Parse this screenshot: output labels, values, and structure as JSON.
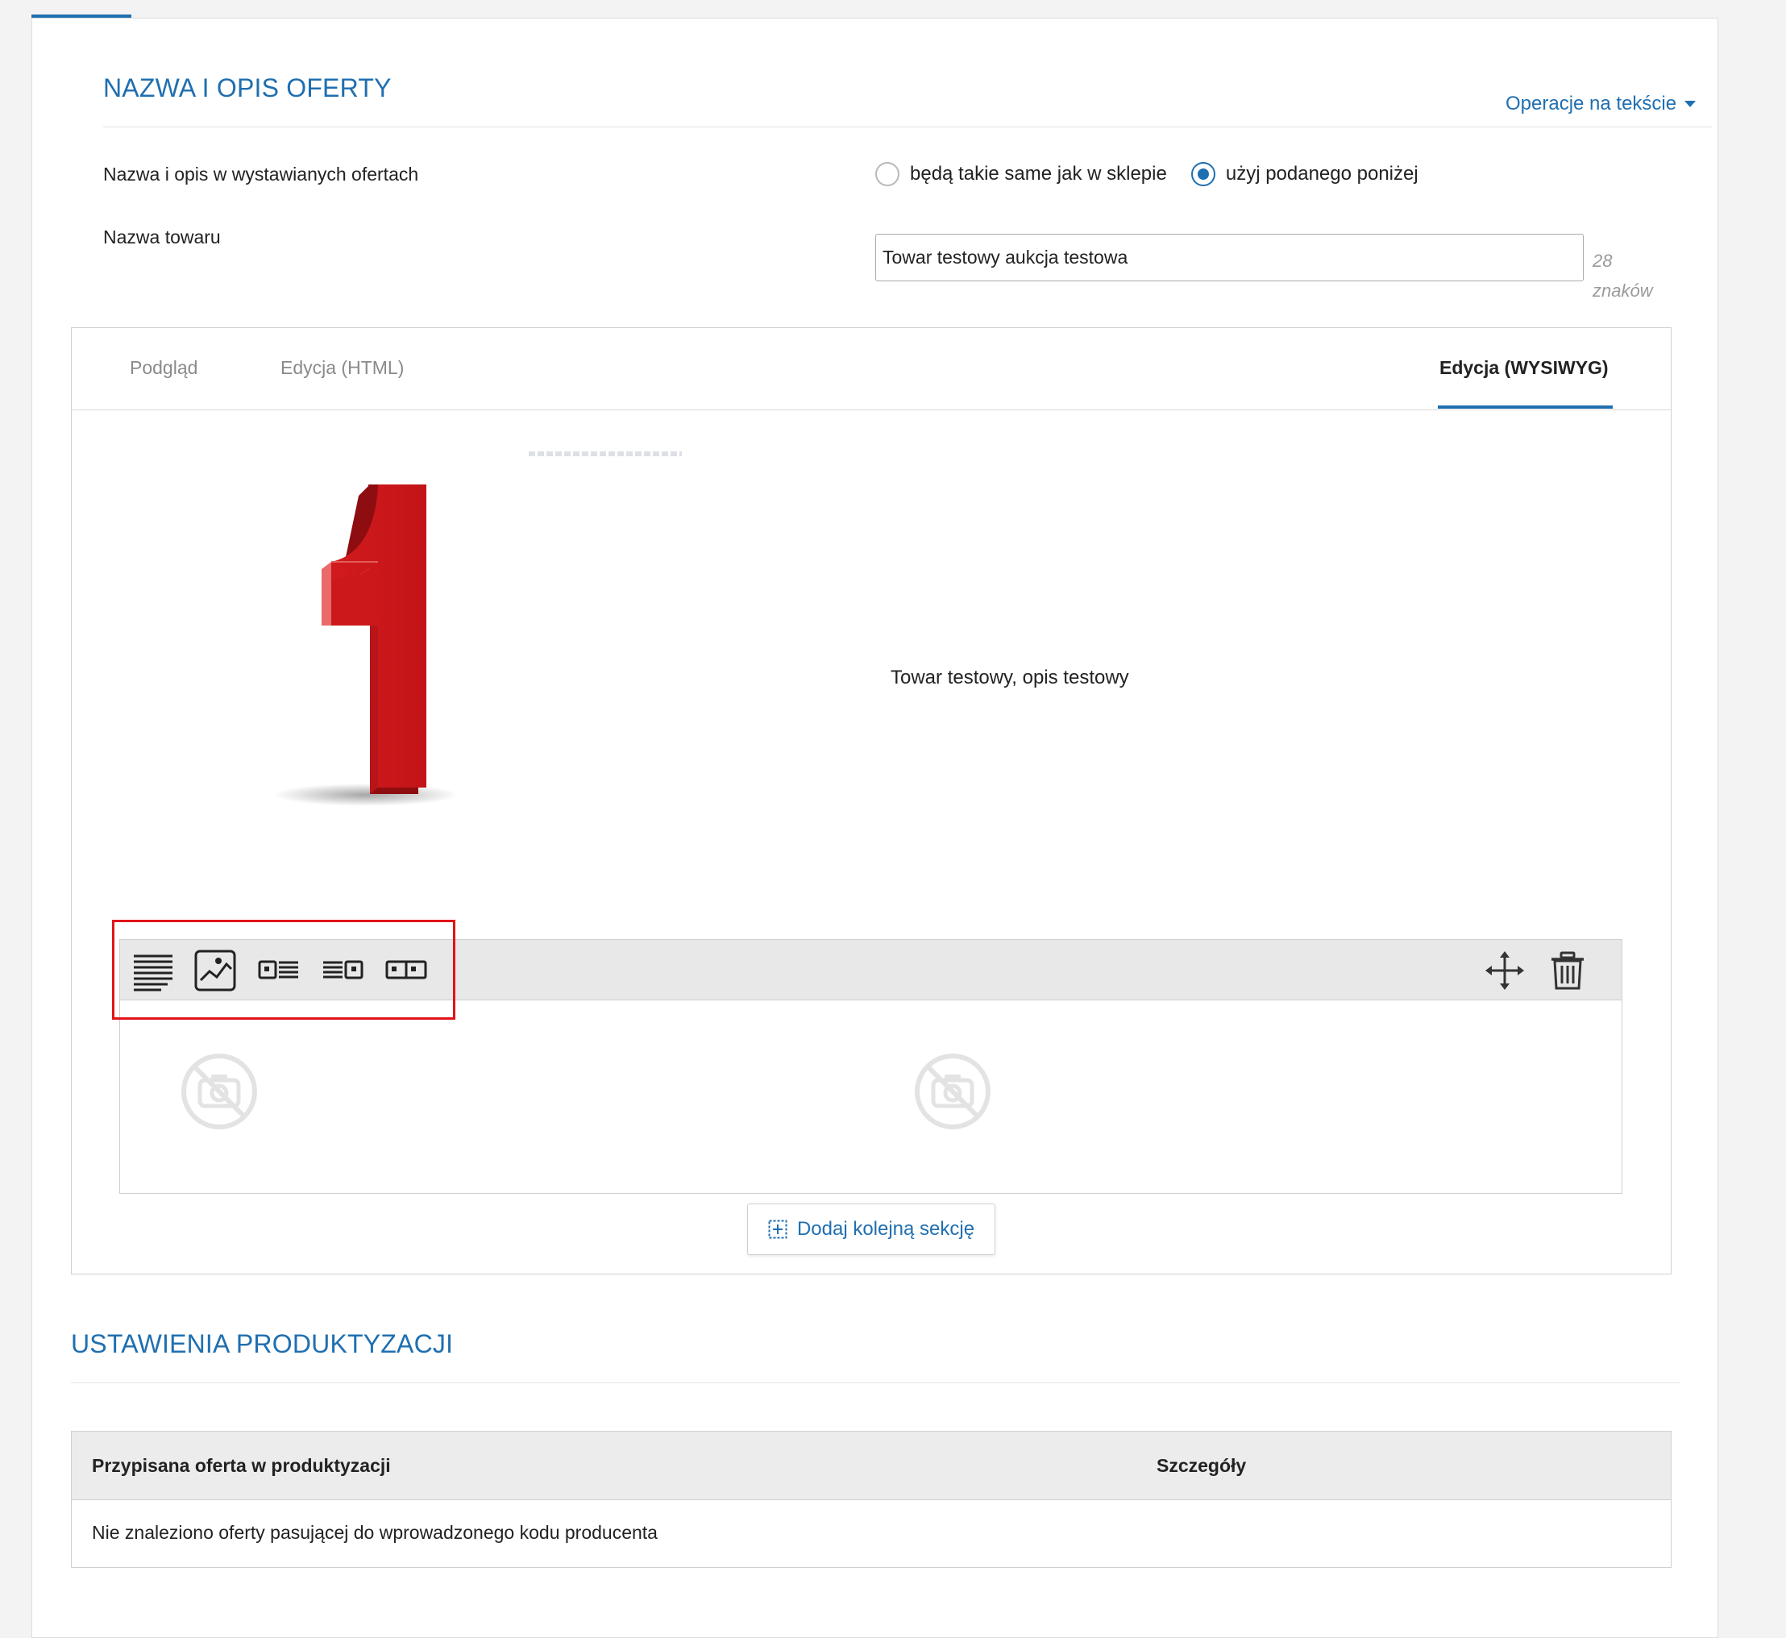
{
  "section1": {
    "title": "NAZWA I OPIS OFERTY",
    "ops_link": "Operacje na tekście"
  },
  "name_desc_row": {
    "label": "Nazwa i opis w wystawianych ofertach",
    "options": [
      {
        "label": "będą takie same jak w sklepie",
        "checked": false
      },
      {
        "label": "użyj podanego poniżej",
        "checked": true
      }
    ]
  },
  "product_name": {
    "label": "Nazwa towaru",
    "value": "Towar testowy aukcja testowa",
    "count": "28",
    "count_unit": "znaków"
  },
  "editor": {
    "tabs": [
      "Podgląd",
      "Edycja (HTML)",
      "Edycja (WYSIWYG)"
    ],
    "active_tab": "Edycja (WYSIWYG)",
    "description_text": "Towar testowy, opis testowy",
    "toolbar_tools": [
      "text-only-icon",
      "image-only-icon",
      "image-left-text-right-icon",
      "text-left-image-right-icon",
      "two-images-icon"
    ],
    "add_section_label": "Dodaj kolejną sekcję",
    "accent_color": "#1f6fb0",
    "highlight_color": "#e0141b"
  },
  "section2": {
    "title": "USTAWIENIA PRODUKTYZACJI",
    "table_headers": [
      "Przypisana oferta w produktyzacji",
      "Szczegóły"
    ],
    "empty_row_text": "Nie znaleziono oferty pasującej do wprowadzonego kodu producenta"
  }
}
